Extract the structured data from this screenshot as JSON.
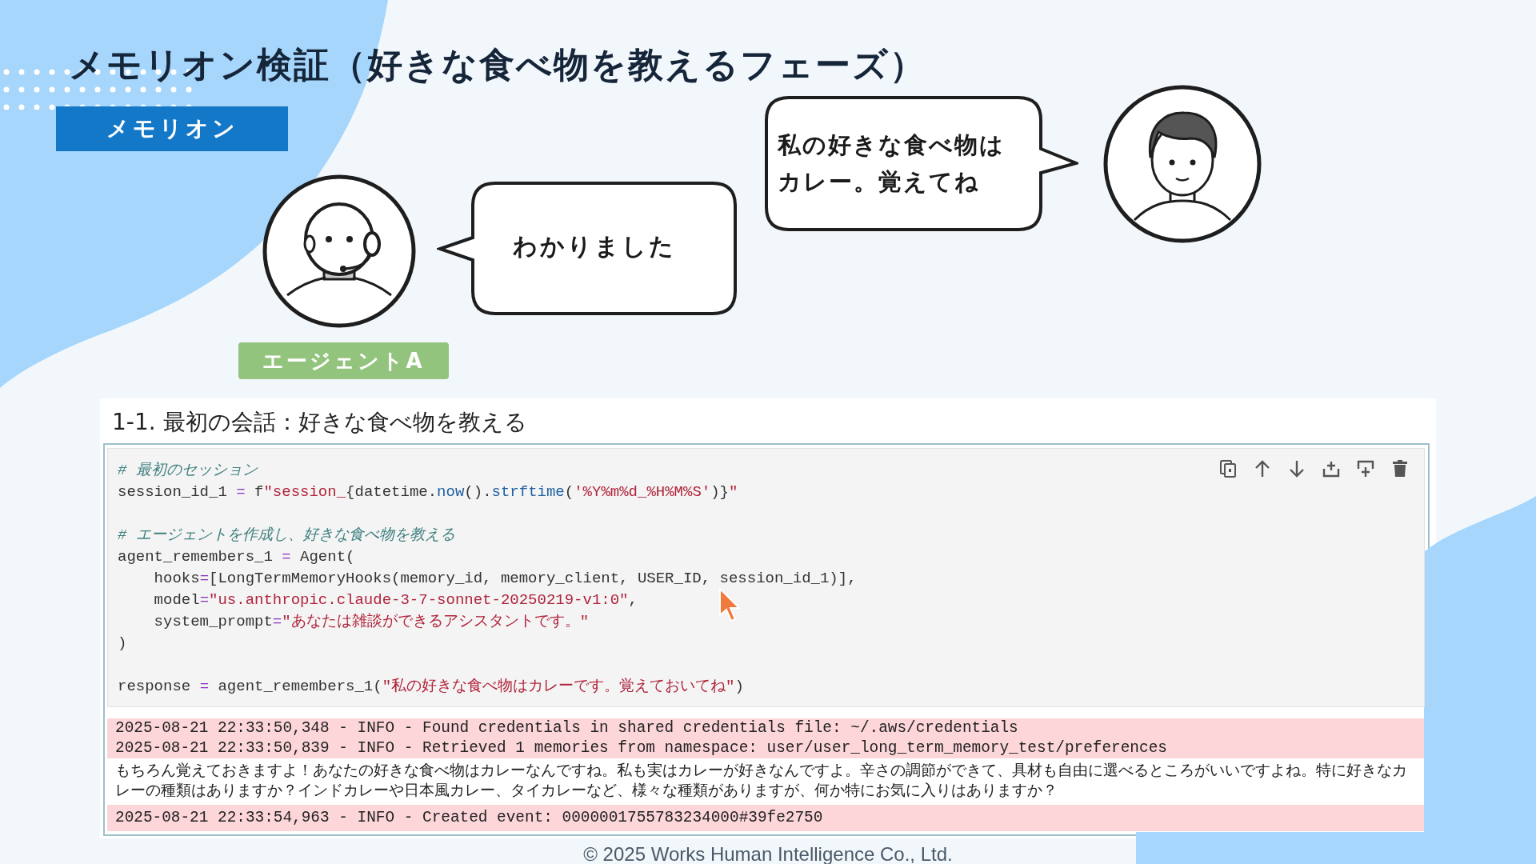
{
  "title": "メモリオン検証（好きな食べ物を教えるフェーズ）",
  "badge": "メモリオン",
  "agent": {
    "speech": "わかりました",
    "label": "エージェントA"
  },
  "user": {
    "speech_lines": [
      "私の好きな食べ物は",
      "カレー。覚えてね"
    ]
  },
  "notebook": {
    "heading": "1-1. 最初の会話：好きな食べ物を教える",
    "code_lines": [
      {
        "kind": "code",
        "tokens": [
          {
            "kind": "comment",
            "text": "# 最初のセッション"
          }
        ]
      },
      {
        "kind": "code",
        "tokens": [
          {
            "kind": "plain",
            "text": "session_id_1 "
          },
          {
            "kind": "op",
            "text": "="
          },
          {
            "kind": "plain",
            "text": " f"
          },
          {
            "kind": "string",
            "text": "\"session_"
          },
          {
            "kind": "plain",
            "text": "{datetime."
          },
          {
            "kind": "func",
            "text": "now"
          },
          {
            "kind": "plain",
            "text": "()."
          },
          {
            "kind": "func",
            "text": "strftime"
          },
          {
            "kind": "plain",
            "text": "("
          },
          {
            "kind": "string",
            "text": "'%Y%m%d_%H%M%S'"
          },
          {
            "kind": "plain",
            "text": ")}"
          },
          {
            "kind": "string",
            "text": "\""
          }
        ]
      },
      {
        "kind": "blank"
      },
      {
        "kind": "code",
        "tokens": [
          {
            "kind": "comment",
            "text": "# エージェントを作成し、好きな食べ物を教える"
          }
        ]
      },
      {
        "kind": "code",
        "tokens": [
          {
            "kind": "plain",
            "text": "agent_remembers_1 "
          },
          {
            "kind": "op",
            "text": "="
          },
          {
            "kind": "plain",
            "text": " Agent("
          }
        ]
      },
      {
        "kind": "code",
        "tokens": [
          {
            "kind": "plain",
            "text": "    hooks"
          },
          {
            "kind": "op",
            "text": "="
          },
          {
            "kind": "plain",
            "text": "[LongTermMemoryHooks(memory_id, memory_client, USER_ID, session_id_1)],"
          }
        ]
      },
      {
        "kind": "code",
        "tokens": [
          {
            "kind": "plain",
            "text": "    model"
          },
          {
            "kind": "op",
            "text": "="
          },
          {
            "kind": "string",
            "text": "\"us.anthropic.claude-3-7-sonnet-20250219-v1:0\""
          },
          {
            "kind": "plain",
            "text": ","
          }
        ]
      },
      {
        "kind": "code",
        "tokens": [
          {
            "kind": "plain",
            "text": "    system_prompt"
          },
          {
            "kind": "op",
            "text": "="
          },
          {
            "kind": "string",
            "text": "\"あなたは雑談ができるアシスタントです。\""
          }
        ]
      },
      {
        "kind": "code",
        "tokens": [
          {
            "kind": "plain",
            "text": ")"
          }
        ]
      },
      {
        "kind": "blank"
      },
      {
        "kind": "code",
        "tokens": [
          {
            "kind": "plain",
            "text": "response "
          },
          {
            "kind": "op",
            "text": "="
          },
          {
            "kind": "plain",
            "text": " agent_remembers_1("
          },
          {
            "kind": "string",
            "text": "\"私の好きな食べ物はカレーです。覚えておいてね\""
          },
          {
            "kind": "plain",
            "text": ")"
          }
        ]
      }
    ],
    "outputs": [
      {
        "kind": "log",
        "text": "2025-08-21 22:33:50,348 - INFO - Found credentials in shared credentials file: ~/.aws/credentials"
      },
      {
        "kind": "log",
        "text": "2025-08-21 22:33:50,839 - INFO - Retrieved 1 memories from namespace: user/user_long_term_memory_test/preferences"
      },
      {
        "kind": "text",
        "text": "もちろん覚えておきますよ！あなたの好きな食べ物はカレーなんですね。私も実はカレーが好きなんですよ。辛さの調節ができて、具材も自由に選べるところがいいですよね。特に好きなカレーの種類はありますか？インドカレーや日本風カレー、タイカレーなど、様々な種類がありますが、何か特にお気に入りはありますか？"
      },
      {
        "kind": "log",
        "text": "2025-08-21 22:33:54,963 - INFO - Created event: 0000001755783234000#39fe2750"
      }
    ]
  },
  "footer": "© 2025 Works Human Intelligence Co., Ltd."
}
